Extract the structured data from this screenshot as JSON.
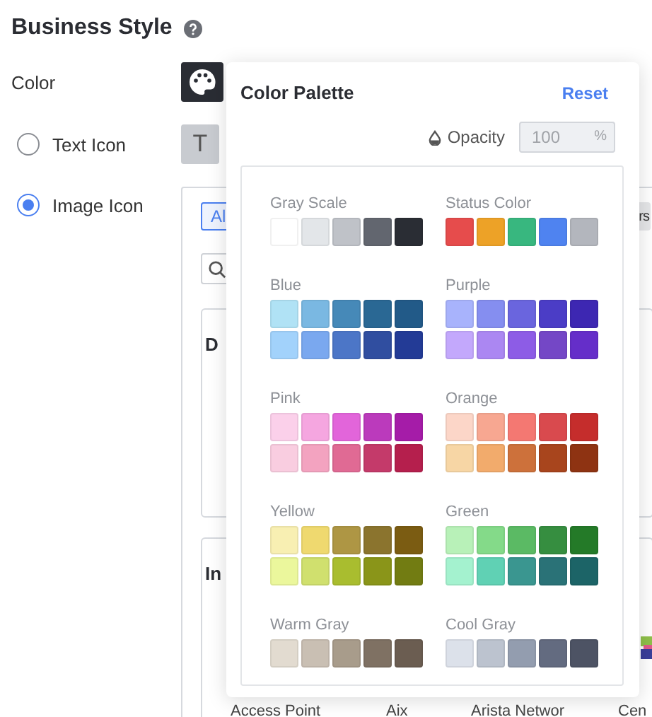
{
  "title": "Business Style",
  "color_label": "Color",
  "icon_options": [
    {
      "label": "Text Icon",
      "selected": false
    },
    {
      "label": "Image Icon",
      "selected": true
    }
  ],
  "text_icon_preview": "T",
  "image_panel": {
    "tabs": [
      {
        "label": "Al",
        "selected": true
      },
      {
        "label": "rs",
        "selected": false
      }
    ],
    "cards": [
      {
        "title": "D"
      },
      {
        "title": "In",
        "items": [
          "Access Point",
          "Aix",
          "Arista Networ",
          "Cen"
        ]
      }
    ]
  },
  "popup": {
    "title": "Color Palette",
    "reset": "Reset",
    "opacity_label": "Opacity",
    "opacity": {
      "value": "100",
      "unit": "%"
    },
    "groups": [
      {
        "name": "Gray Scale",
        "swatches": [
          {
            "color": "#ffffff"
          },
          {
            "color": "#e3e6e9"
          },
          {
            "color": "#bfc2c8"
          },
          {
            "color": "#62666f"
          },
          {
            "color": "#2a2d34"
          }
        ]
      },
      {
        "name": "Status Color",
        "swatches": [
          {
            "color": "#e64c4c"
          },
          {
            "color": "#eda227"
          },
          {
            "color": "#38b77f"
          },
          {
            "color": "#4f83f0"
          },
          {
            "color": "#b3b6bd"
          }
        ]
      },
      {
        "name": "Blue",
        "swatches": [
          {
            "color": "#b0e2f5"
          },
          {
            "color": "#7ab8e2"
          },
          {
            "color": "#4689b8"
          },
          {
            "color": "#2a6894"
          },
          {
            "color": "#225a88"
          },
          {
            "color": "#a2d2fb"
          },
          {
            "color": "#7aa8ef"
          },
          {
            "color": "#4c76c7"
          },
          {
            "color": "#304ea0"
          },
          {
            "color": "#233b96"
          }
        ]
      },
      {
        "name": "Purple",
        "swatches": [
          {
            "color": "#a8b3fc"
          },
          {
            "color": "#858ef0"
          },
          {
            "color": "#6a65de"
          },
          {
            "color": "#4b3dc6"
          },
          {
            "color": "#3d27b2"
          },
          {
            "color": "#c3a8fc"
          },
          {
            "color": "#ab87f2"
          },
          {
            "color": "#8d5ce6"
          },
          {
            "color": "#7447c6"
          },
          {
            "color": "#652ec9"
          }
        ]
      },
      {
        "name": "Pink",
        "swatches": [
          {
            "color": "#fbd0ea"
          },
          {
            "color": "#f5a6e0"
          },
          {
            "color": "#e265da"
          },
          {
            "color": "#bb3abc"
          },
          {
            "color": "#a51ca8"
          },
          {
            "color": "#f9cde0"
          },
          {
            "color": "#f3a3c0"
          },
          {
            "color": "#e06a94"
          },
          {
            "color": "#c43a6a"
          },
          {
            "color": "#b51f4d"
          }
        ]
      },
      {
        "name": "Orange",
        "swatches": [
          {
            "color": "#fcd6c8"
          },
          {
            "color": "#f7a791"
          },
          {
            "color": "#f47872"
          },
          {
            "color": "#d94a4e"
          },
          {
            "color": "#c52d2c"
          },
          {
            "color": "#f7d6a5"
          },
          {
            "color": "#f2ab6c"
          },
          {
            "color": "#cd713b"
          },
          {
            "color": "#a8451d"
          },
          {
            "color": "#8e3312"
          }
        ]
      },
      {
        "name": "Yellow",
        "swatches": [
          {
            "color": "#f8efb2"
          },
          {
            "color": "#efd96f"
          },
          {
            "color": "#ae9644"
          },
          {
            "color": "#8b742e"
          },
          {
            "color": "#7b5c12"
          },
          {
            "color": "#ebf79c"
          },
          {
            "color": "#d0e06e"
          },
          {
            "color": "#a9bd2f"
          },
          {
            "color": "#8a9519"
          },
          {
            "color": "#727c12"
          }
        ]
      },
      {
        "name": "Green",
        "swatches": [
          {
            "color": "#b8f1b8"
          },
          {
            "color": "#84da89"
          },
          {
            "color": "#5bba64"
          },
          {
            "color": "#368e40"
          },
          {
            "color": "#247a28"
          },
          {
            "color": "#a4f2cf"
          },
          {
            "color": "#60d1b4"
          },
          {
            "color": "#3a9690"
          },
          {
            "color": "#2a7277"
          },
          {
            "color": "#1c6467"
          }
        ]
      },
      {
        "name": "Warm Gray",
        "swatches": [
          {
            "color": "#e2dbd0"
          },
          {
            "color": "#c9bfb3"
          },
          {
            "color": "#a89c8b"
          },
          {
            "color": "#7f7163"
          },
          {
            "color": "#6b5d51"
          }
        ]
      },
      {
        "name": "Cool Gray",
        "swatches": [
          {
            "color": "#dce1ea"
          },
          {
            "color": "#bcc3cf"
          },
          {
            "color": "#939daf"
          },
          {
            "color": "#636b80"
          },
          {
            "color": "#4d5364"
          }
        ]
      }
    ]
  }
}
